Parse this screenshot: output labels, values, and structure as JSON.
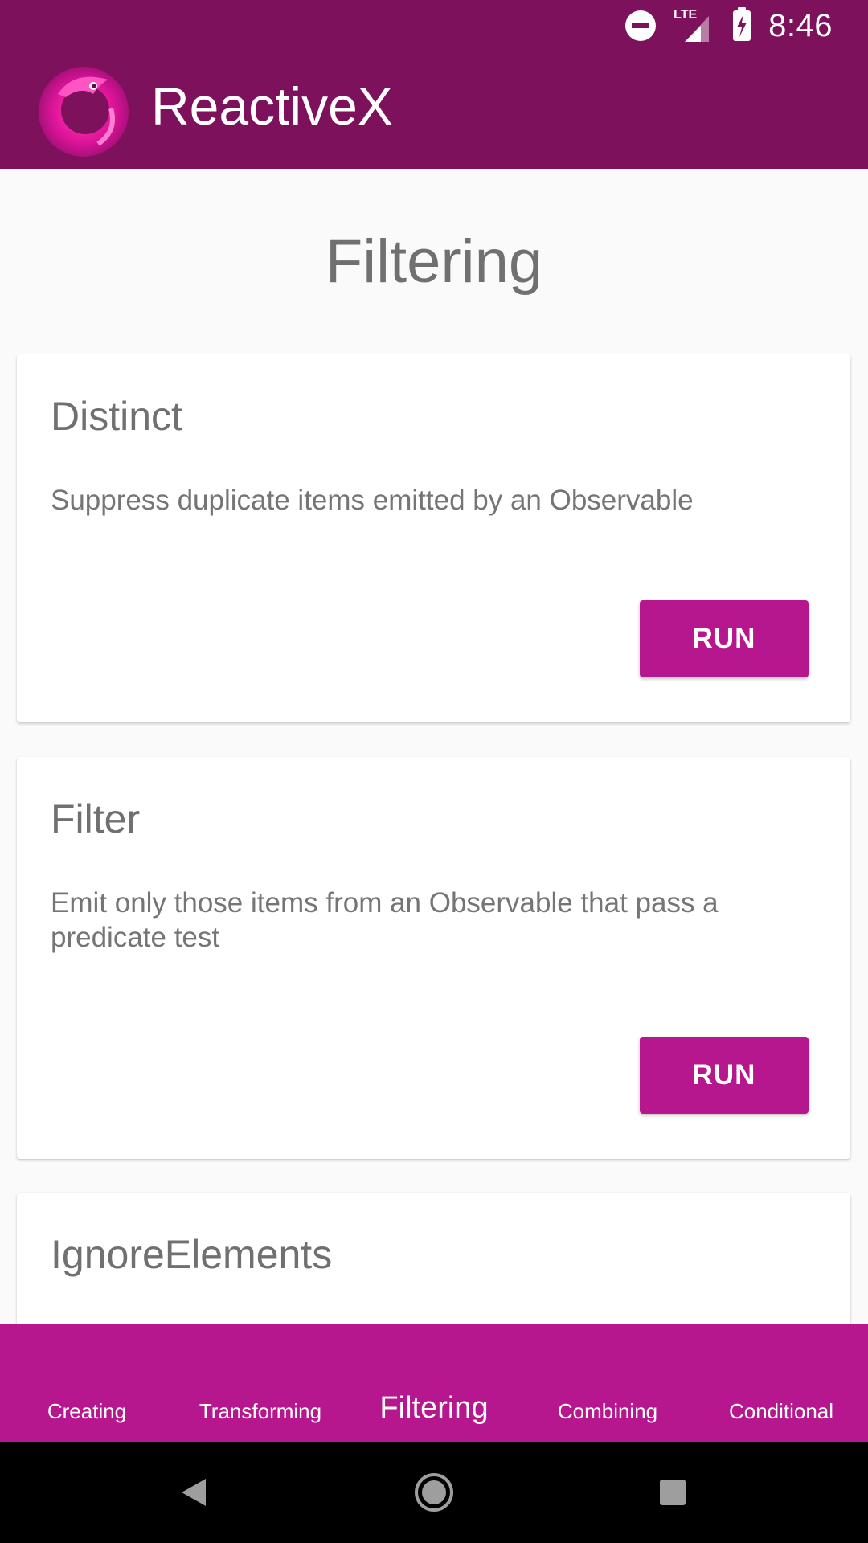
{
  "status_bar": {
    "time": "8:46",
    "network_label": "LTE",
    "icons": [
      "do-not-disturb-icon",
      "lte-signal-icon",
      "battery-charging-icon"
    ]
  },
  "app_bar": {
    "title": "ReactiveX",
    "logo_icon": "reactivex-eel-logo",
    "background": "#7e115c"
  },
  "page": {
    "title": "Filtering"
  },
  "cards": [
    {
      "title": "Distinct",
      "description": "Suppress duplicate items emitted by an Observable",
      "button_label": "RUN"
    },
    {
      "title": "Filter",
      "description": "Emit only those items from an Observable that pass a predicate test",
      "button_label": "RUN"
    },
    {
      "title": "IgnoreElements",
      "description": "",
      "button_label": ""
    }
  ],
  "bottom_nav": {
    "items": [
      "Creating",
      "Transforming",
      "Filtering",
      "Combining",
      "Conditional"
    ],
    "active": "Filtering",
    "background": "#b6178e"
  },
  "system_nav": {
    "icons": [
      "back-icon",
      "home-icon",
      "recents-icon"
    ]
  },
  "colors": {
    "primary_dark": "#7e115c",
    "accent": "#b6178e",
    "text_secondary": "#707070"
  }
}
